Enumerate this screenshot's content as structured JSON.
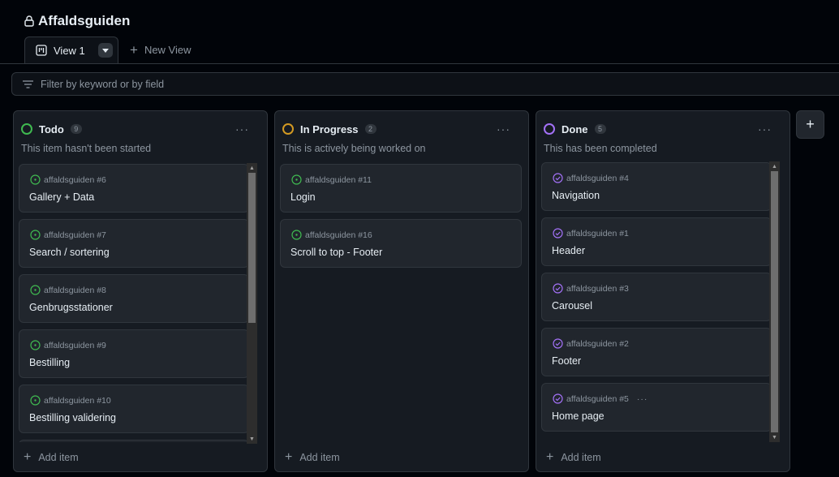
{
  "project": {
    "title": "Affaldsguiden"
  },
  "views": {
    "active_label": "View 1",
    "new_view_label": "New View"
  },
  "filter": {
    "placeholder": "Filter by keyword or by field"
  },
  "colors": {
    "todo": "#3fb950",
    "in_progress": "#d29922",
    "done": "#a371f7",
    "open_issue": "#3fb950",
    "closed_issue": "#a371f7"
  },
  "columns": [
    {
      "name": "Todo",
      "count": "9",
      "description": "This item hasn't been started",
      "add_label": "Add item",
      "cards": [
        {
          "ref": "affaldsguiden #6",
          "title": "Gallery + Data",
          "icon": "issue-open-icon"
        },
        {
          "ref": "affaldsguiden #7",
          "title": "Search / sortering",
          "icon": "issue-open-icon"
        },
        {
          "ref": "affaldsguiden #8",
          "title": "Genbrugsstationer",
          "icon": "issue-open-icon"
        },
        {
          "ref": "affaldsguiden #9",
          "title": "Bestilling",
          "icon": "issue-open-icon"
        },
        {
          "ref": "affaldsguiden #10",
          "title": "Bestilling validering",
          "icon": "issue-open-icon"
        }
      ]
    },
    {
      "name": "In Progress",
      "count": "2",
      "description": "This is actively being worked on",
      "add_label": "Add item",
      "cards": [
        {
          "ref": "affaldsguiden #11",
          "title": "Login",
          "icon": "issue-open-icon"
        },
        {
          "ref": "affaldsguiden #16",
          "title": "Scroll to top - Footer",
          "icon": "issue-open-icon"
        }
      ]
    },
    {
      "name": "Done",
      "count": "5",
      "description": "This has been completed",
      "add_label": "Add item",
      "cards": [
        {
          "ref": "affaldsguiden #4",
          "title": "Navigation",
          "icon": "issue-closed-icon"
        },
        {
          "ref": "affaldsguiden #1",
          "title": "Header",
          "icon": "issue-closed-icon"
        },
        {
          "ref": "affaldsguiden #3",
          "title": "Carousel",
          "icon": "issue-closed-icon"
        },
        {
          "ref": "affaldsguiden #2",
          "title": "Footer",
          "icon": "issue-closed-icon"
        },
        {
          "ref": "affaldsguiden #5",
          "title": "Home page",
          "icon": "issue-closed-icon"
        }
      ]
    }
  ]
}
